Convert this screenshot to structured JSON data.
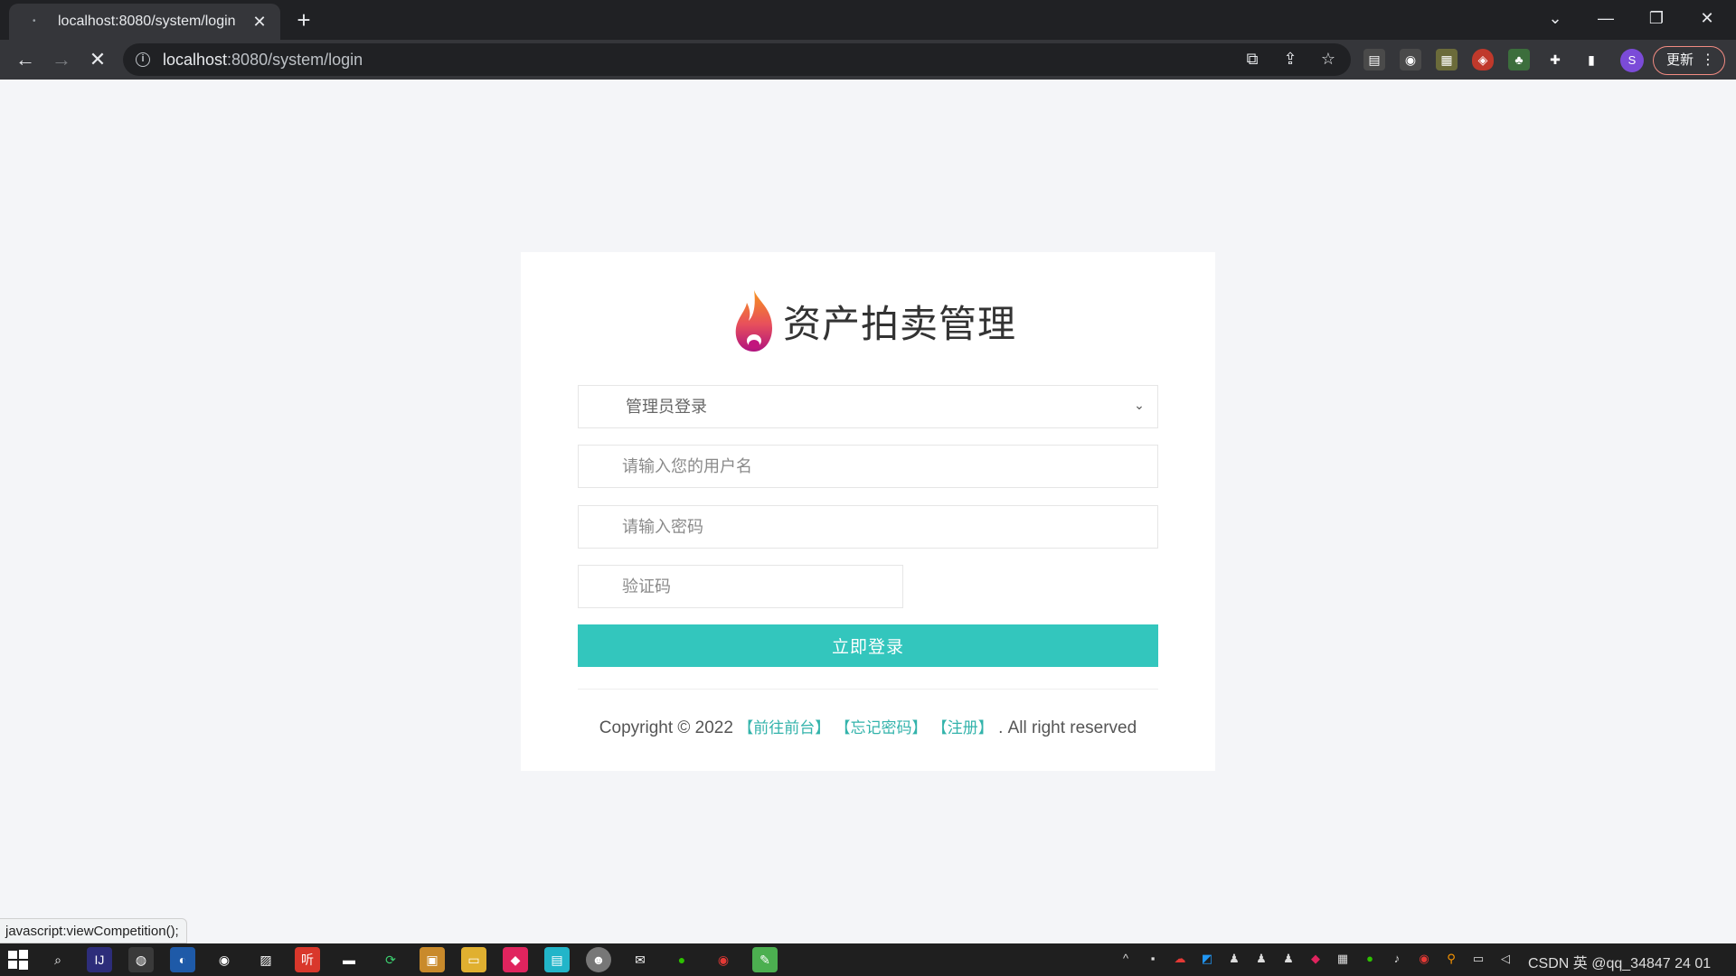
{
  "browser": {
    "tab_title": "localhost:8080/system/login",
    "new_tab_label": "+",
    "url_host": "localhost",
    "url_rest": ":8080/system/login",
    "profile_initial": "S",
    "update_label": "更新",
    "window_controls": [
      "minimize-icon",
      "restore-icon",
      "close-icon"
    ]
  },
  "login": {
    "logo_text": "资产拍卖管理",
    "role_selected": "管理员登录",
    "username_placeholder": "请输入您的用户名",
    "password_placeholder": "请输入密码",
    "captcha_placeholder": "验证码",
    "submit_label": "立即登录",
    "footer": {
      "prefix": "Copyright © 2022",
      "link_front": "【前往前台】",
      "link_forgot": "【忘记密码】",
      "link_register": "【注册】",
      "suffix": ". All right reserved"
    }
  },
  "status_bar": "javascript:viewCompetition();",
  "taskbar": {
    "tray_text": "CSDN 英 @qq_34847 24 01"
  },
  "colors": {
    "accent": "#33c6bd",
    "link": "#33b3ab",
    "page_bg": "#f4f5f8",
    "chrome_dark": "#202124",
    "chrome_toolbar": "#35363a"
  }
}
